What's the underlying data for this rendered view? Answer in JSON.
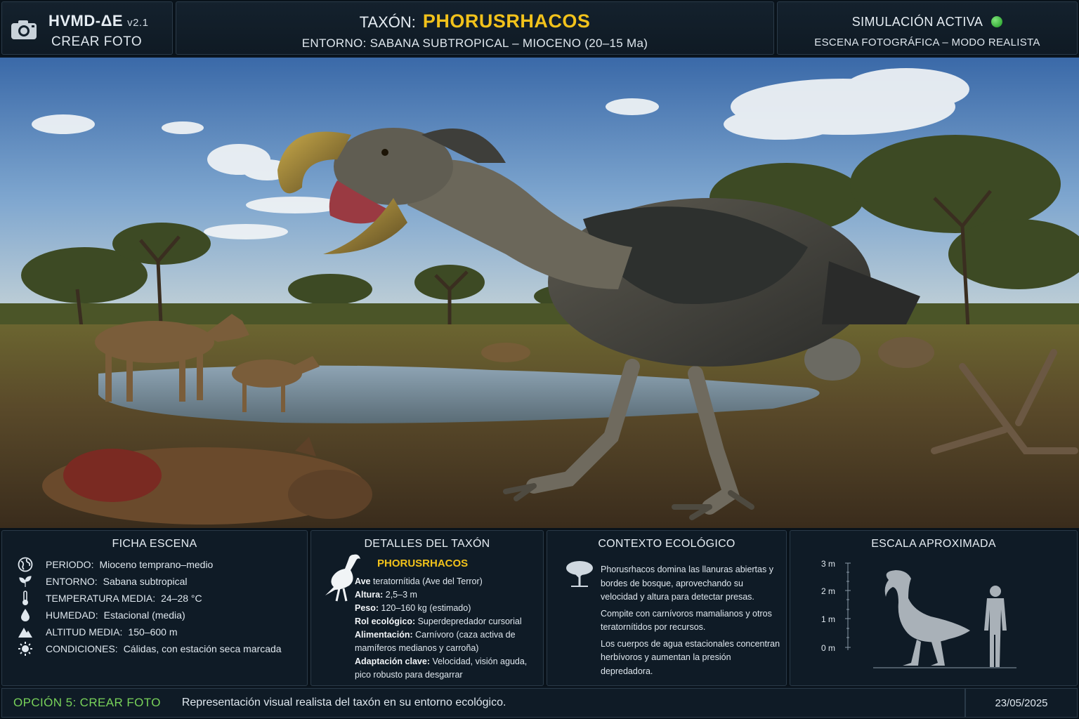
{
  "header": {
    "brand": "HVMD-ΔE",
    "version": "v2.1",
    "mode": "CREAR FOTO",
    "taxon_label": "TAXÓN:",
    "taxon_name": "PHORUSRHACOS",
    "environment": "ENTORNO: SABANA SUBTROPICAL – MIOCENO (20–15 Ma)",
    "status": "SIMULACIÓN ACTIVA",
    "scene_mode": "ESCENA FOTOGRÁFICA – MODO REALISTA",
    "accent_color": "#f2c21b",
    "status_color": "#2fb82f"
  },
  "scene": {
    "title": "Phorusrhacos photographic scene"
  },
  "ficha": {
    "title": "FICHA ESCENA",
    "rows": [
      {
        "icon": "globe-icon",
        "key": "PERIODO:",
        "value": "Mioceno temprano–medio"
      },
      {
        "icon": "leaf-icon",
        "key": "ENTORNO:",
        "value": "Sabana subtropical"
      },
      {
        "icon": "thermometer-icon",
        "key": "TEMPERATURA MEDIA:",
        "value": "24–28 °C"
      },
      {
        "icon": "drop-icon",
        "key": "HUMEDAD:",
        "value": "Estacional (media)"
      },
      {
        "icon": "mountain-icon",
        "key": "ALTITUD MEDIA:",
        "value": "150–600 m"
      },
      {
        "icon": "sun-icon",
        "key": "CONDICIONES:",
        "value": "Cálidas, con estación seca marcada"
      }
    ]
  },
  "taxon": {
    "title": "DETALLES DEL TAXÓN",
    "name": "PHORUSRHACOS",
    "rows": [
      {
        "k": "Ave",
        "v": " teratornítida (Ave del Terror)"
      },
      {
        "k": "Altura:",
        "v": " 2,5–3 m"
      },
      {
        "k": "Peso:",
        "v": " 120–160 kg (estimado)"
      },
      {
        "k": "Rol ecológico:",
        "v": " Superdepredador cursorial"
      },
      {
        "k": "Alimentación:",
        "v": " Carnívoro (caza activa de mamíferos medianos y carroña)"
      },
      {
        "k": "Adaptación clave:",
        "v": " Velocidad, visión aguda, pico robusto para desgarrar"
      }
    ]
  },
  "eco": {
    "title": "CONTEXTO ECOLÓGICO",
    "paragraphs": [
      "Phorusrhacos domina las llanuras abiertas y bordes de bosque, aprovechando su velocidad y altura para detectar presas.",
      "Compite con carnívoros mamalianos y otros teratornítidos por recursos.",
      "Los cuerpos de agua estacionales concentran herbívoros y aumentan la presión depredadora."
    ]
  },
  "scale": {
    "title": "ESCALA APROXIMADA",
    "ticks": [
      "3 m",
      "2 m",
      "1 m",
      "0 m"
    ],
    "bird_height_m": 2.7,
    "human_height_m": 1.8
  },
  "footer": {
    "option": "OPCIÓN 5:  CREAR FOTO",
    "description": "Representación visual realista del taxón en su entorno ecológico.",
    "date": "23/05/2025"
  }
}
